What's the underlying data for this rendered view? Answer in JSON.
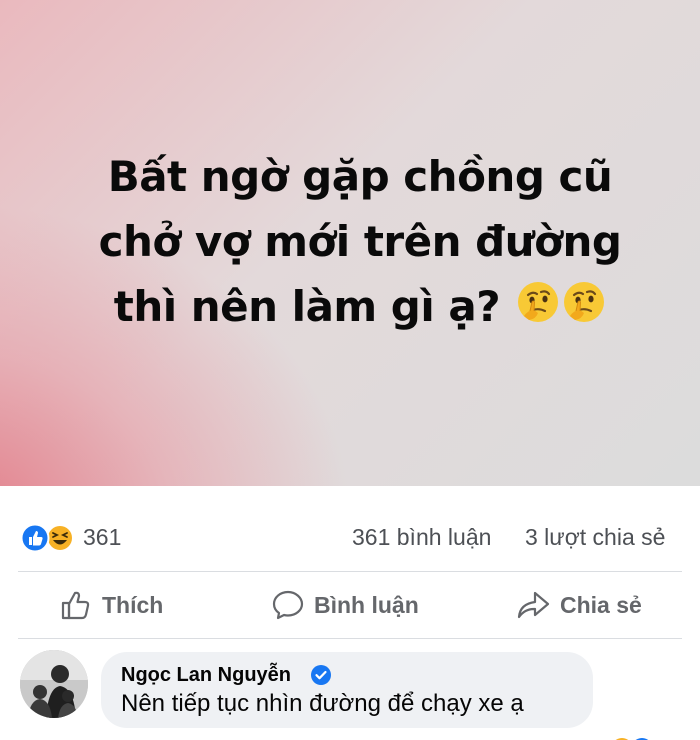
{
  "post": {
    "line1": "Bất ngờ gặp chồng cũ",
    "line2": "chở vợ mới trên đường",
    "line3": "thì nên làm gì ạ?",
    "emoji": "thinking-face-icon"
  },
  "stats": {
    "reactions": "361",
    "comments": "361 bình luận",
    "shares": "3 lượt chia sẻ"
  },
  "actions": {
    "like": "Thích",
    "comment": "Bình luận",
    "share": "Chia sẻ"
  },
  "comment": {
    "author": "Ngọc Lan Nguyễn",
    "text": "Nên tiếp tục nhìn đường để chạy xe ạ"
  },
  "colors": {
    "like_blue": "#1877f2",
    "haha_yellow": "#f7b125",
    "gray_text": "#65676b"
  }
}
